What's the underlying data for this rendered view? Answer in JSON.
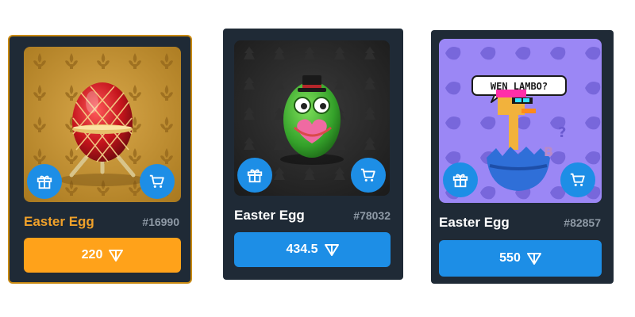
{
  "colors": {
    "card_bg": "#1f2a36",
    "accent_blue": "#1d8ee6",
    "accent_gold": "#ffa21a",
    "selected_border": "#c98a12"
  },
  "cards": [
    {
      "name": "Easter Egg",
      "id": "#16990",
      "price": "220",
      "selected": true,
      "buttons": [
        "gift-icon",
        "cart-icon"
      ]
    },
    {
      "name": "Easter Egg",
      "id": "#78032",
      "price": "434.5",
      "selected": false,
      "buttons": [
        "gift-icon",
        "cart-icon"
      ]
    },
    {
      "name": "Easter Egg",
      "id": "#82857",
      "price": "550",
      "selected": false,
      "buttons": [
        "gift-icon",
        "cart-icon"
      ],
      "speech_bubble": "WEN LAMBO?"
    }
  ]
}
